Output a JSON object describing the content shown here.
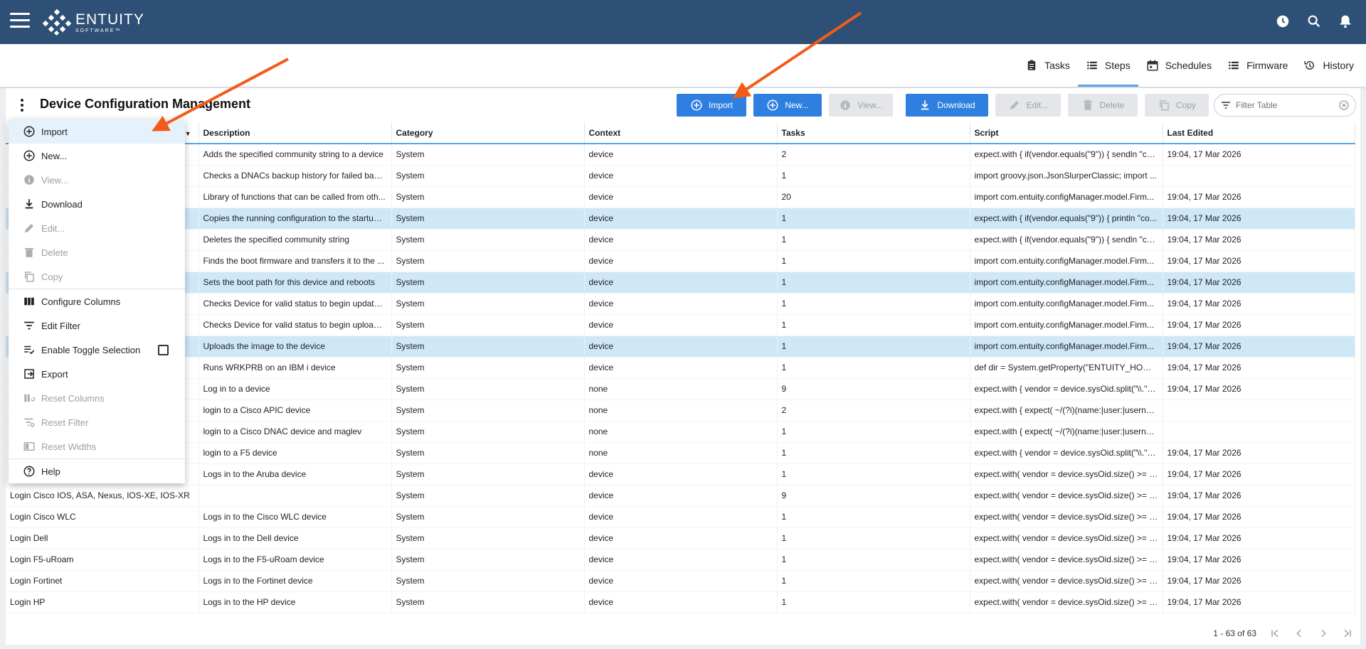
{
  "app": {
    "brand_name": "ENTUITY",
    "brand_sub": "SOFTWARE™",
    "header_icons": [
      "user-clock-icon",
      "search-icon",
      "bell-icon"
    ]
  },
  "tabs": [
    {
      "label": "Tasks",
      "icon": "clipboard-icon",
      "active": false
    },
    {
      "label": "Steps",
      "icon": "list-icon",
      "active": true
    },
    {
      "label": "Schedules",
      "icon": "calendar-icon",
      "active": false
    },
    {
      "label": "Firmware",
      "icon": "list-icon",
      "active": false
    },
    {
      "label": "History",
      "icon": "history-icon",
      "active": false
    }
  ],
  "page": {
    "title": "Device Configuration Management"
  },
  "toolbar": {
    "import_label": "Import",
    "new_label": "New...",
    "view_label": "View...",
    "download_label": "Download",
    "edit_label": "Edit...",
    "delete_label": "Delete",
    "copy_label": "Copy",
    "filter_placeholder": "Filter Table"
  },
  "table": {
    "columns": [
      "Description",
      "Category",
      "Context",
      "Tasks",
      "Script",
      "Last Edited"
    ],
    "rows": [
      {
        "name": "",
        "description": "Adds the specified community string to a device",
        "category": "System",
        "context": "device",
        "tasks": "2",
        "script": "expect.with { if(vendor.equals(\"9\")) { sendln \"co...",
        "last_edited": "19:04, 17 Mar 2026",
        "selected": false
      },
      {
        "name": "",
        "description": "Checks a DNACs backup history for failed back...",
        "category": "System",
        "context": "device",
        "tasks": "1",
        "script": "import groovy.json.JsonSlurperClassic; import ...",
        "last_edited": "",
        "selected": false
      },
      {
        "name": "",
        "description": "Library of functions that can be called from oth...",
        "category": "System",
        "context": "device",
        "tasks": "20",
        "script": "import com.entuity.configManager.model.Firm...",
        "last_edited": "19:04, 17 Mar 2026",
        "selected": false
      },
      {
        "name": "",
        "description": "Copies the running configuration to the startup ...",
        "category": "System",
        "context": "device",
        "tasks": "1",
        "script": "expect.with { if(vendor.equals(\"9\")) { println \"co...",
        "last_edited": "19:04, 17 Mar 2026",
        "selected": true
      },
      {
        "name": "",
        "description": "Deletes the specified community string",
        "category": "System",
        "context": "device",
        "tasks": "1",
        "script": "expect.with { if(vendor.equals(\"9\")) { sendln \"co...",
        "last_edited": "19:04, 17 Mar 2026",
        "selected": false
      },
      {
        "name": "",
        "description": "Finds the boot firmware and transfers it to the ...",
        "category": "System",
        "context": "device",
        "tasks": "1",
        "script": "import com.entuity.configManager.model.Firm...",
        "last_edited": "19:04, 17 Mar 2026",
        "selected": false
      },
      {
        "name": "",
        "description": "Sets the boot path for this device and reboots",
        "category": "System",
        "context": "device",
        "tasks": "1",
        "script": "import com.entuity.configManager.model.Firm...",
        "last_edited": "19:04, 17 Mar 2026",
        "selected": true
      },
      {
        "name": "",
        "description": "Checks Device for valid status to begin update ...",
        "category": "System",
        "context": "device",
        "tasks": "1",
        "script": "import com.entuity.configManager.model.Firm...",
        "last_edited": "19:04, 17 Mar 2026",
        "selected": false
      },
      {
        "name": "",
        "description": "Checks Device for valid status to begin upload ...",
        "category": "System",
        "context": "device",
        "tasks": "1",
        "script": "import com.entuity.configManager.model.Firm...",
        "last_edited": "19:04, 17 Mar 2026",
        "selected": false
      },
      {
        "name": "",
        "description": "Uploads the image to the device",
        "category": "System",
        "context": "device",
        "tasks": "1",
        "script": "import com.entuity.configManager.model.Firm...",
        "last_edited": "19:04, 17 Mar 2026",
        "selected": true
      },
      {
        "name": "",
        "description": "Runs WRKPRB on an IBM i device",
        "category": "System",
        "context": "device",
        "tasks": "1",
        "script": "def dir = System.getProperty(\"ENTUITY_HOME\"...",
        "last_edited": "19:04, 17 Mar 2026",
        "selected": false
      },
      {
        "name": "",
        "description": "Log in to a device",
        "category": "System",
        "context": "none",
        "tasks": "9",
        "script": "expect.with { vendor = device.sysOid.split(\"\\\\.\")[...",
        "last_edited": "19:04, 17 Mar 2026",
        "selected": false
      },
      {
        "name": "",
        "description": "login to a Cisco APIC device",
        "category": "System",
        "context": "none",
        "tasks": "2",
        "script": "expect.with { expect( ~/(?i)(name:|user:|userna...",
        "last_edited": "",
        "selected": false
      },
      {
        "name": "",
        "description": "login to a Cisco DNAC device and maglev",
        "category": "System",
        "context": "none",
        "tasks": "1",
        "script": "expect.with { expect( ~/(?i)(name:|user:|userna...",
        "last_edited": "",
        "selected": false
      },
      {
        "name": "",
        "description": "login to a F5 device",
        "category": "System",
        "context": "none",
        "tasks": "1",
        "script": "expect.with { vendor = device.sysOid.split(\"\\\\.\")[...",
        "last_edited": "19:04, 17 Mar 2026",
        "selected": false
      },
      {
        "name": "",
        "description": "Logs in to the Aruba device",
        "category": "System",
        "context": "device",
        "tasks": "1",
        "script": "expect.with( vendor = device.sysOid.size() >= 7...",
        "last_edited": "19:04, 17 Mar 2026",
        "selected": false
      },
      {
        "name": "Login Cisco IOS, ASA, Nexus, IOS-XE, IOS-XR",
        "description": "",
        "category": "System",
        "context": "device",
        "tasks": "9",
        "script": "expect.with( vendor = device.sysOid.size() >= 7...",
        "last_edited": "19:04, 17 Mar 2026",
        "selected": false
      },
      {
        "name": "Login Cisco WLC",
        "description": "Logs in to the Cisco WLC device",
        "category": "System",
        "context": "device",
        "tasks": "1",
        "script": "expect.with( vendor = device.sysOid.size() >= 7...",
        "last_edited": "19:04, 17 Mar 2026",
        "selected": false
      },
      {
        "name": "Login Dell",
        "description": "Logs in to the Dell device",
        "category": "System",
        "context": "device",
        "tasks": "1",
        "script": "expect.with( vendor = device.sysOid.size() >= 7...",
        "last_edited": "19:04, 17 Mar 2026",
        "selected": false
      },
      {
        "name": "Login F5-uRoam",
        "description": "Logs in to the F5-uRoam device",
        "category": "System",
        "context": "device",
        "tasks": "1",
        "script": "expect.with( vendor = device.sysOid.size() >= 7...",
        "last_edited": "19:04, 17 Mar 2026",
        "selected": false
      },
      {
        "name": "Login Fortinet",
        "description": "Logs in to the Fortinet device",
        "category": "System",
        "context": "device",
        "tasks": "1",
        "script": "expect.with( vendor = device.sysOid.size() >= 7...",
        "last_edited": "19:04, 17 Mar 2026",
        "selected": false
      },
      {
        "name": "Login HP",
        "description": "Logs in to the HP device",
        "category": "System",
        "context": "device",
        "tasks": "1",
        "script": "expect.with( vendor = device.sysOid.size() >= 7...",
        "last_edited": "19:04, 17 Mar 2026",
        "selected": false
      }
    ]
  },
  "menu": {
    "items": [
      {
        "label": "Import",
        "icon": "plus-circle-icon",
        "disabled": false,
        "sep_after": false
      },
      {
        "label": "New...",
        "icon": "plus-circle-icon",
        "disabled": false,
        "sep_after": false
      },
      {
        "label": "View...",
        "icon": "info-icon",
        "disabled": true,
        "sep_after": false
      },
      {
        "label": "Download",
        "icon": "download-icon",
        "disabled": false,
        "sep_after": false
      },
      {
        "label": "Edit...",
        "icon": "pencil-icon",
        "disabled": true,
        "sep_after": false
      },
      {
        "label": "Delete",
        "icon": "trash-icon",
        "disabled": true,
        "sep_after": false
      },
      {
        "label": "Copy",
        "icon": "copy-icon",
        "disabled": true,
        "sep_after": true
      },
      {
        "label": "Configure Columns",
        "icon": "columns-icon",
        "disabled": false,
        "sep_after": false
      },
      {
        "label": "Edit Filter",
        "icon": "filter-icon",
        "disabled": false,
        "sep_after": false
      },
      {
        "label": "Enable Toggle Selection",
        "icon": "checklist-icon",
        "disabled": false,
        "sep_after": false
      },
      {
        "label": "Export",
        "icon": "export-icon",
        "disabled": false,
        "sep_after": false
      },
      {
        "label": "Reset Columns",
        "icon": "reset-columns-icon",
        "disabled": true,
        "sep_after": false
      },
      {
        "label": "Reset Filter",
        "icon": "reset-filter-icon",
        "disabled": true,
        "sep_after": false
      },
      {
        "label": "Reset Widths",
        "icon": "reset-widths-icon",
        "disabled": true,
        "sep_after": true
      },
      {
        "label": "Help",
        "icon": "help-icon",
        "disabled": false,
        "sep_after": false
      }
    ]
  },
  "pager": {
    "range_label": "1 - 63 of 63"
  },
  "colors": {
    "header_bg": "#2e5076",
    "primary": "#2f7fe0",
    "selected_row": "#cfe8f8",
    "annotation_arrow": "#f25c18"
  }
}
